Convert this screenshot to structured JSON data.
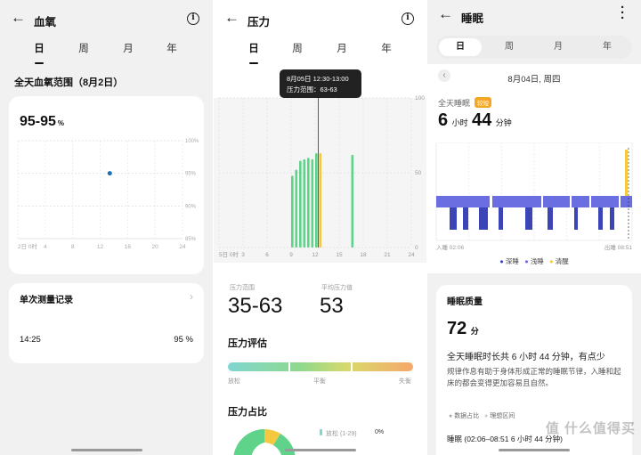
{
  "blood_oxygen": {
    "title": "血氧",
    "tabs": [
      "日",
      "周",
      "月",
      "年"
    ],
    "range_title": "全天血氧范围（8月2日）",
    "value": "95-95",
    "unit": "%",
    "y_ticks": [
      "100%",
      "95%",
      "90%",
      "85%"
    ],
    "x_ticks": [
      "2日 0时",
      "4",
      "8",
      "12",
      "16",
      "20",
      "24"
    ],
    "point": {
      "hour": 13.4,
      "percent": 95
    },
    "record_title": "单次测量记录",
    "record_time": "14:25",
    "record_value": "95 %"
  },
  "stress": {
    "title": "压力",
    "tabs": [
      "日",
      "周",
      "月",
      "年"
    ],
    "tooltip_time": "8月05日 12:30-13:00",
    "tooltip_range": "压力范围：63-63",
    "y_ticks": [
      "100",
      "50",
      "0"
    ],
    "x_ticks": [
      "5日 0时",
      "3",
      "6",
      "9",
      "12",
      "15",
      "18",
      "21",
      "24"
    ],
    "bars": [
      {
        "hour": 9.0,
        "value": 48
      },
      {
        "hour": 9.5,
        "value": 52
      },
      {
        "hour": 10.0,
        "value": 58
      },
      {
        "hour": 10.5,
        "value": 59
      },
      {
        "hour": 11.0,
        "value": 60
      },
      {
        "hour": 11.5,
        "value": 59
      },
      {
        "hour": 12.0,
        "value": 63
      },
      {
        "hour": 16.5,
        "value": 62
      }
    ],
    "selected_hour": 12.5,
    "range_label": "压力范围",
    "range_value": "35-63",
    "avg_label": "平均压力值",
    "avg_value": "53",
    "eval_title": "压力评估",
    "eval_labels": [
      "放松",
      "平衡",
      "失衡"
    ],
    "share_title": "压力占比",
    "legend_relax": "放松 (1-29)",
    "legend_relax_pct": "0%",
    "colors": {
      "relax": "#5fd38a",
      "normal": "#7fcfe0",
      "selected": "#f5c842"
    }
  },
  "sleep": {
    "title": "睡眠",
    "tabs": [
      "日",
      "周",
      "月",
      "年"
    ],
    "date": "8月04日, 周四",
    "total_label": "全天睡眠",
    "badge": "较短",
    "hours": "6",
    "hours_unit": "小时",
    "minutes": "44",
    "minutes_unit": "分钟",
    "start_time": "入睡 02:06",
    "end_time": "出睡 08:51",
    "legend": [
      "深睡",
      "浅睡",
      "清醒"
    ],
    "quality_title": "睡眠质量",
    "score": "72",
    "score_unit": "分",
    "summary": "全天睡眠时长共 6 小时 44 分钟，有点少",
    "advice": "规律作息有助于身体形成正常的睡眠节律，入睡和起床的都会变得更加容易且自然。",
    "tag1": "数据占比",
    "tag2": "理想区间",
    "detail": "睡眠 (02:06–08:51  6 小时 44 分钟)",
    "colors": {
      "deep": "#3b45b8",
      "light": "#6b6ee0",
      "awake": "#f5c842"
    }
  },
  "watermark": "值 什么值得买"
}
